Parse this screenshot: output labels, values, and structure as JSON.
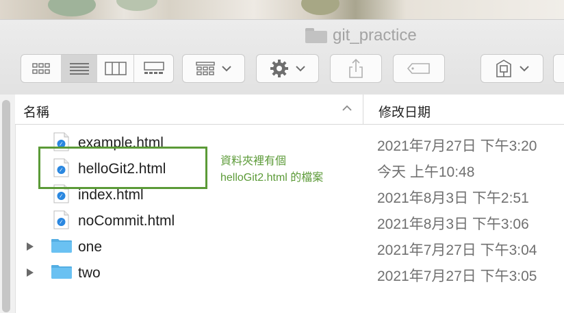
{
  "window": {
    "title": "git_practice"
  },
  "toolbar": {
    "view_modes": [
      "icon-view",
      "list-view",
      "column-view",
      "gallery-view"
    ],
    "active_view": "list-view",
    "buttons": [
      "group-button",
      "action-gear-button",
      "share-button",
      "tag-button",
      "dropbox-button"
    ]
  },
  "columns": {
    "name": "名稱",
    "date_modified": "修改日期"
  },
  "files": [
    {
      "name": "example.html",
      "date": "2021年7月27日 下午3:20",
      "kind": "html"
    },
    {
      "name": "helloGit2.html",
      "date": "今天 上午10:48",
      "kind": "html"
    },
    {
      "name": "index.html",
      "date": "2021年8月3日 下午2:51",
      "kind": "html"
    },
    {
      "name": "noCommit.html",
      "date": "2021年8月3日 下午3:06",
      "kind": "html"
    },
    {
      "name": "one",
      "date": "2021年7月27日 下午3:04",
      "kind": "folder"
    },
    {
      "name": "two",
      "date": "2021年7月27日 下午3:05",
      "kind": "folder"
    }
  ],
  "annotation": {
    "line1": "資料夾裡有個",
    "line2": "helloGit2.html 的檔案",
    "color": "#5b9a37"
  },
  "colors": {
    "folder_blue": "#6ac1f2",
    "safari_blue": "#2a87e0"
  }
}
